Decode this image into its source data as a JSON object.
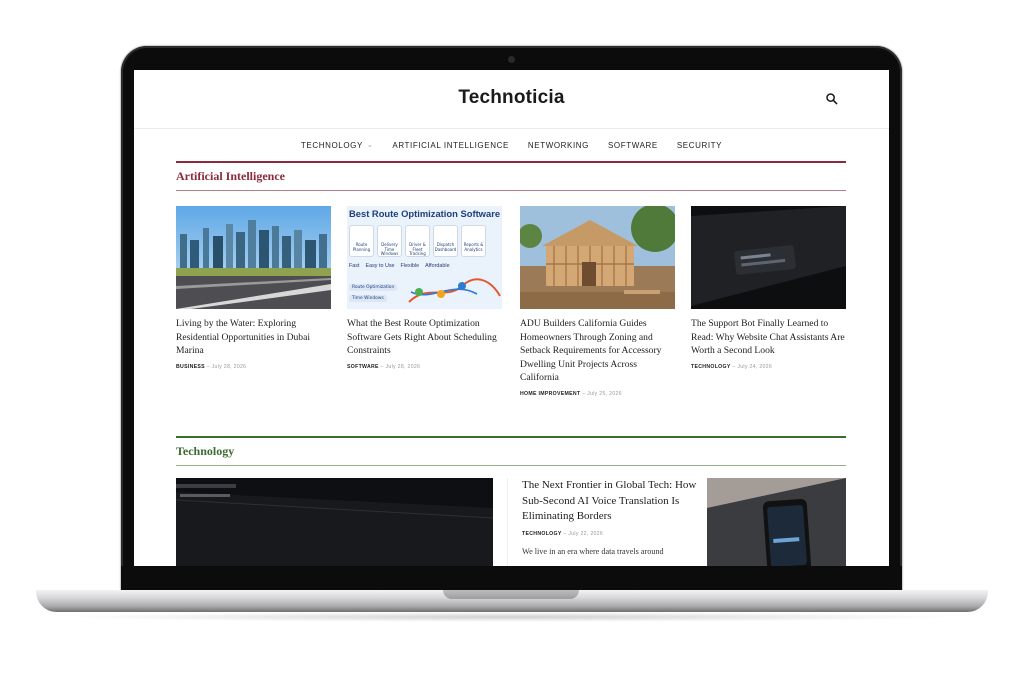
{
  "site": {
    "logo": "Technoticia",
    "icons": {
      "search": "search-icon"
    }
  },
  "nav": {
    "items": [
      {
        "label": "TECHNOLOGY",
        "has_dropdown": true
      },
      {
        "label": "ARTIFICIAL INTELLIGENCE"
      },
      {
        "label": "NETWORKING"
      },
      {
        "label": "SOFTWARE"
      },
      {
        "label": "SECURITY"
      }
    ]
  },
  "sections": {
    "ai": {
      "title": "Artificial Intelligence",
      "color": "#8b2a3a",
      "articles": [
        {
          "title": "Living by the Water: Exploring Residential Opportunities in Dubai Marina",
          "category": "BUSINESS",
          "date": "July 28, 2026",
          "image": "dubai-skyline-photo"
        },
        {
          "title": "What the Best Route Optimization Software Gets Right About Scheduling Constraints",
          "category": "SOFTWARE",
          "date": "July 28, 2026",
          "image": "route-optimization-infographic",
          "image_text": {
            "heading": "Best Route Optimization Software",
            "features": [
              "Route Planning",
              "Delivery Time Windows",
              "Driver & Fleet Tracking",
              "Dispatch Dashboard",
              "Reports & Analytics"
            ],
            "benefits": [
              "Fast",
              "Easy to Use",
              "Flexible",
              "Affordable"
            ],
            "tags": [
              "Route Optimization",
              "Time Windows"
            ]
          }
        },
        {
          "title": "ADU Builders California Guides Homeowners Through Zoning and Setback Requirements for Accessory Dwelling Unit Projects Across California",
          "category": "HOME IMPROVEMENT",
          "date": "July 25, 2026",
          "image": "wood-frame-house-photo"
        },
        {
          "title": "The Support Bot Finally Learned to Read: Why Website Chat Assistants Are Worth a Second Look",
          "category": "TECHNOLOGY",
          "date": "July 24, 2026",
          "image": "dark-chat-screen-photo"
        }
      ]
    },
    "technology": {
      "title": "Technology",
      "color": "#3b6b2f",
      "feature_image": "dark-browser-screen-photo",
      "side_article": {
        "title": "The Next Frontier in Global Tech: How Sub-Second AI Voice Translation Is Eliminating Borders",
        "category": "TECHNOLOGY",
        "date": "July 22, 2026",
        "excerpt": "We live in an era where data travels around",
        "image": "phone-on-laptop-photo"
      }
    }
  }
}
